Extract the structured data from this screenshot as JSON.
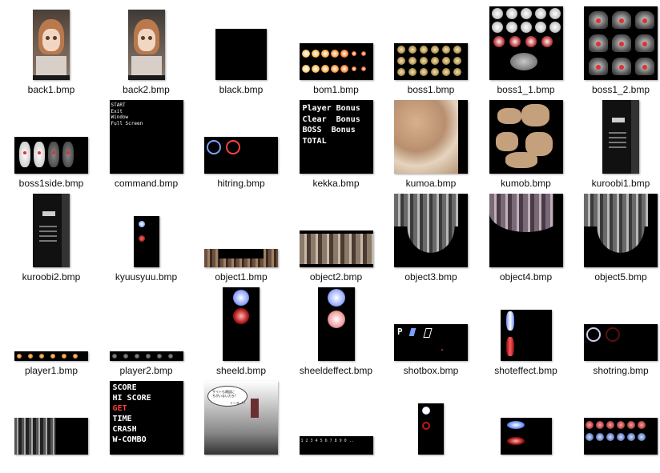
{
  "files": [
    {
      "name": "back1.bmp",
      "thumb_w": 46,
      "thumb_h": 88,
      "kind": "girl1"
    },
    {
      "name": "back2.bmp",
      "thumb_w": 46,
      "thumb_h": 88,
      "kind": "girl2"
    },
    {
      "name": "black.bmp",
      "thumb_w": 64,
      "thumb_h": 64,
      "kind": "black"
    },
    {
      "name": "bom1.bmp",
      "thumb_w": 92,
      "thumb_h": 46,
      "kind": "bom"
    },
    {
      "name": "boss1.bmp",
      "thumb_w": 92,
      "thumb_h": 46,
      "kind": "bossrow"
    },
    {
      "name": "boss1_1.bmp",
      "thumb_w": 92,
      "thumb_h": 92,
      "kind": "bossgrid"
    },
    {
      "name": "boss1_2.bmp",
      "thumb_w": 92,
      "thumb_h": 92,
      "kind": "bossgrid2"
    },
    {
      "name": "boss1side.bmp",
      "thumb_w": 92,
      "thumb_h": 46,
      "kind": "bossside"
    },
    {
      "name": "command.bmp",
      "thumb_w": 92,
      "thumb_h": 92,
      "kind": "command",
      "lines": [
        "START",
        "Exit",
        "Window",
        "Full Screen"
      ]
    },
    {
      "name": "hitring.bmp",
      "thumb_w": 92,
      "thumb_h": 46,
      "kind": "hitring"
    },
    {
      "name": "kekka.bmp",
      "thumb_w": 92,
      "thumb_h": 92,
      "kind": "kekka",
      "lines": [
        "Player Bonus",
        "Clear  Bonus",
        "BOSS  Bonus",
        "TOTAL"
      ]
    },
    {
      "name": "kumoa.bmp",
      "thumb_w": 92,
      "thumb_h": 92,
      "kind": "kumoa"
    },
    {
      "name": "kumob.bmp",
      "thumb_w": 92,
      "thumb_h": 92,
      "kind": "kumob"
    },
    {
      "name": "kuroobi1.bmp",
      "thumb_w": 46,
      "thumb_h": 92,
      "kind": "kuroobi1"
    },
    {
      "name": "kuroobi2.bmp",
      "thumb_w": 46,
      "thumb_h": 92,
      "kind": "kuroobi2"
    },
    {
      "name": "kyuusyuu.bmp",
      "thumb_w": 32,
      "thumb_h": 64,
      "kind": "kyuusyuu"
    },
    {
      "name": "object1.bmp",
      "thumb_w": 92,
      "thumb_h": 23,
      "kind": "object1"
    },
    {
      "name": "object2.bmp",
      "thumb_w": 92,
      "thumb_h": 46,
      "kind": "object2"
    },
    {
      "name": "object3.bmp",
      "thumb_w": 92,
      "thumb_h": 92,
      "kind": "object3"
    },
    {
      "name": "object4.bmp",
      "thumb_w": 92,
      "thumb_h": 92,
      "kind": "object4"
    },
    {
      "name": "object5.bmp",
      "thumb_w": 92,
      "thumb_h": 92,
      "kind": "object5"
    },
    {
      "name": "player1.bmp",
      "thumb_w": 92,
      "thumb_h": 12,
      "kind": "player1"
    },
    {
      "name": "player2.bmp",
      "thumb_w": 92,
      "thumb_h": 12,
      "kind": "player2"
    },
    {
      "name": "sheeld.bmp",
      "thumb_w": 46,
      "thumb_h": 92,
      "kind": "sheeld"
    },
    {
      "name": "sheeldeffect.bmp",
      "thumb_w": 46,
      "thumb_h": 92,
      "kind": "sheeldeffect"
    },
    {
      "name": "shotbox.bmp",
      "thumb_w": 92,
      "thumb_h": 46,
      "kind": "shotbox"
    },
    {
      "name": "shoteffect.bmp",
      "thumb_w": 64,
      "thumb_h": 64,
      "kind": "shoteffect"
    },
    {
      "name": "shotring.bmp",
      "thumb_w": 92,
      "thumb_h": 46,
      "kind": "shotring"
    },
    {
      "name": "",
      "thumb_w": 92,
      "thumb_h": 46,
      "kind": "row5a"
    },
    {
      "name": "",
      "thumb_w": 92,
      "thumb_h": 92,
      "kind": "score",
      "lines": [
        "SCORE",
        "HI SCORE",
        "GET",
        "TIME",
        "CRASH",
        "W-COMBO"
      ]
    },
    {
      "name": "",
      "thumb_w": 92,
      "thumb_h": 92,
      "kind": "dialog",
      "lines": [
        "サイトも建設に",
        "ちがいないだろ？",
        "トーキ…!!"
      ]
    },
    {
      "name": "",
      "thumb_w": 92,
      "thumb_h": 23,
      "kind": "digits",
      "lines": [
        "1 2 3 4 5 6 7 8 9 0 .."
      ]
    },
    {
      "name": "",
      "thumb_w": 32,
      "thumb_h": 64,
      "kind": "row5e"
    },
    {
      "name": "",
      "thumb_w": 64,
      "thumb_h": 46,
      "kind": "row5f"
    },
    {
      "name": "",
      "thumb_w": 92,
      "thumb_h": 46,
      "kind": "row5g"
    }
  ]
}
